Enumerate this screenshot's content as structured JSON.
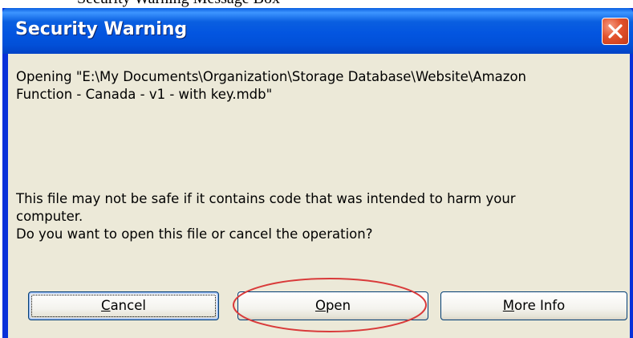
{
  "caption": {
    "fragment": "Security Warning Message Box"
  },
  "window": {
    "title": "Security Warning"
  },
  "message": {
    "path_line1": "Opening \"E:\\My Documents\\Organization\\Storage Database\\Website\\Amazon",
    "path_line2": "Function - Canada - v1 - with key.mdb\"",
    "warning_line1": "This file may not be safe if it contains code that was intended to harm your",
    "warning_line2": "computer.",
    "warning_line3": "Do you want to open this file or cancel the operation?"
  },
  "buttons": {
    "cancel": {
      "mnemonic": "C",
      "rest": "ancel"
    },
    "open": {
      "mnemonic": "O",
      "rest": "pen"
    },
    "more_info": {
      "mnemonic": "M",
      "rest": "ore Info"
    }
  },
  "annotation": {
    "color": "#d93a3a",
    "target": "open-button"
  },
  "colors": {
    "titlebar": "#0a5fe0",
    "client_background": "#ece9d8",
    "close_button": "#e2512c"
  },
  "icons": {
    "close": "close-icon"
  }
}
